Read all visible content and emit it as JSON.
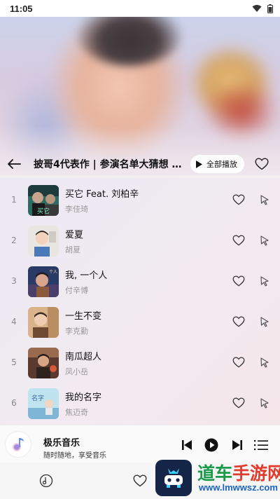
{
  "status_bar": {
    "time": "11:05"
  },
  "header": {
    "playlist_title": "披哥4代表作 | 参演名单大猜想 …",
    "play_all_label": "全部播放"
  },
  "songs": [
    {
      "index": "1",
      "title": "买它 Feat. 刘柏辛",
      "artist": "李佳琦"
    },
    {
      "index": "2",
      "title": "爱夏",
      "artist": "胡夏"
    },
    {
      "index": "3",
      "title": "我, 一个人",
      "artist": "付辛博"
    },
    {
      "index": "4",
      "title": "一生不变",
      "artist": "李克勤"
    },
    {
      "index": "5",
      "title": "南瓜超人",
      "artist": "凤小岳"
    },
    {
      "index": "6",
      "title": "我的名字",
      "artist": "焦迈奇"
    }
  ],
  "player": {
    "app_name": "极乐音乐",
    "slogan": "随时随地，享受音乐"
  },
  "watermark": {
    "title_a": "道车",
    "title_b": "手游网",
    "url": "www.lmwwsz.com"
  },
  "colors": {
    "accent_green": "#1a9b4a",
    "accent_red": "#e23b2e",
    "watermark_blue": "#1b63c2"
  }
}
